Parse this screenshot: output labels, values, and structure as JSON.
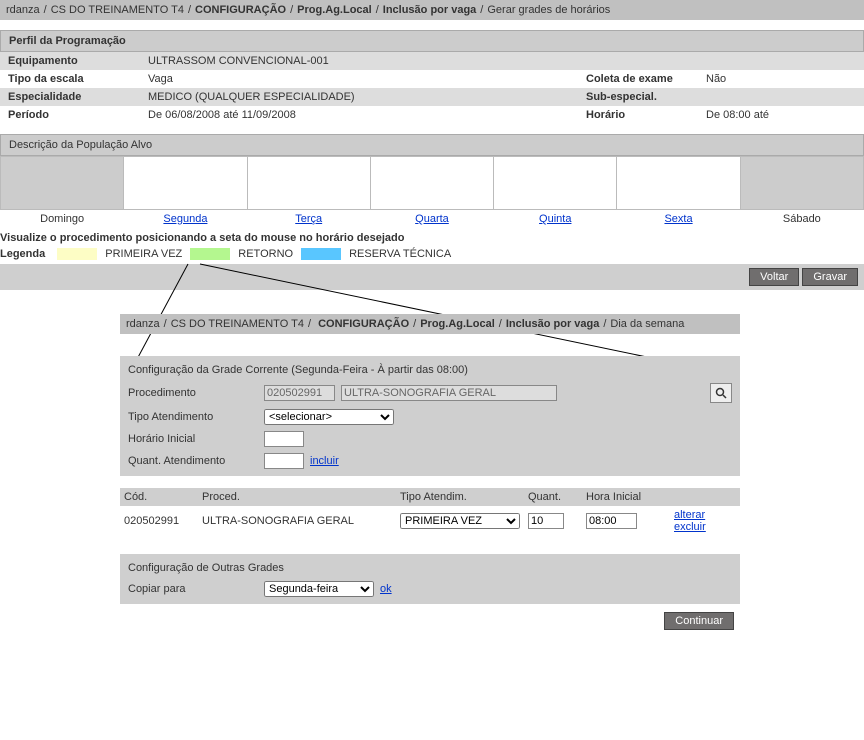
{
  "bc_top": {
    "user": "rdanza",
    "env": "CS DO TREINAMENTO T4",
    "config": "CONFIGURAÇÃO",
    "prog": "Prog.Ag.Local",
    "incl": "Inclusão por vaga",
    "page": "Gerar grades de horários"
  },
  "perfil": {
    "title": "Perfil da Programação",
    "equip_label": "Equipamento",
    "equip_val": "ULTRASSOM CONVENCIONAL-001",
    "tipo_label": "Tipo da escala",
    "tipo_val": "Vaga",
    "coleta_label": "Coleta de exame",
    "coleta_val": "Não",
    "esp_label": "Especialidade",
    "esp_val": "MEDICO (QUALQUER ESPECIALIDADE)",
    "sub_label": "Sub-especial.",
    "sub_val": "",
    "periodo_label": "Período",
    "periodo_val": "De 06/08/2008 até 11/09/2008",
    "hor_label": "Horário",
    "hor_val": "De 08:00 até"
  },
  "pop": {
    "title": "Descrição da População Alvo",
    "days": [
      "Domingo",
      "Segunda",
      "Terça",
      "Quarta",
      "Quinta",
      "Sexta",
      "Sábado"
    ]
  },
  "instr": "Visualize o procedimento posicionando a seta do mouse no horário desejado",
  "legend": {
    "label": "Legenda",
    "primeira": "PRIMEIRA VEZ",
    "retorno": "RETORNO",
    "reserva": "RESERVA TÉCNICA"
  },
  "buttons": {
    "voltar": "Voltar",
    "gravar": "Gravar",
    "continuar": "Continuar"
  },
  "bc_detail": {
    "user": "rdanza",
    "env": "CS DO TREINAMENTO T4",
    "config": "CONFIGURAÇÃO",
    "prog": "Prog.Ag.Local",
    "incl": "Inclusão por vaga",
    "page": "Dia da semana"
  },
  "grade": {
    "title": "Configuração da Grade Corrente (Segunda-Feira - À partir das 08:00)",
    "proc_label": "Procedimento",
    "proc_code": "020502991",
    "proc_name": "ULTRA-SONOGRAFIA GERAL",
    "tipo_label": "Tipo Atendimento",
    "tipo_sel": "<selecionar>",
    "hora_label": "Horário Inicial",
    "qtd_label": "Quant. Atendimento",
    "incluir": "incluir"
  },
  "list": {
    "h_cod": "Cód.",
    "h_proc": "Proced.",
    "h_tipo": "Tipo Atendim.",
    "h_quant": "Quant.",
    "h_hora": "Hora Inicial",
    "row": {
      "cod": "020502991",
      "proc": "ULTRA-SONOGRAFIA GERAL",
      "tipo": "PRIMEIRA VEZ",
      "quant": "10",
      "hora": "08:00",
      "alterar": "alterar",
      "excluir": "excluir"
    }
  },
  "outras": {
    "title": "Configuração de Outras Grades",
    "copiar_label": "Copiar para",
    "sel": "Segunda-feira",
    "ok": "ok"
  }
}
